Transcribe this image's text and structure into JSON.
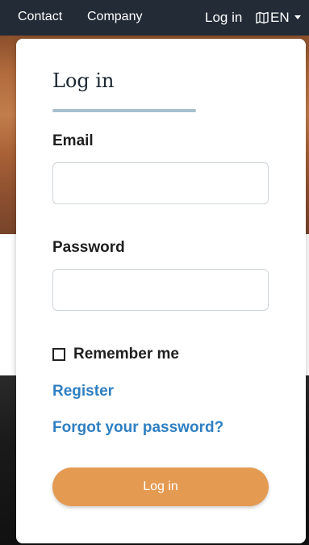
{
  "nav": {
    "contact": "Contact",
    "company": "Company",
    "login": "Log in",
    "language": "EN",
    "language_icon": "map-icon",
    "dropdown_icon": "caret-down-icon",
    "background": "#222b36"
  },
  "login_form": {
    "title": "Log in",
    "email_label": "Email",
    "email_value": "",
    "email_placeholder": "",
    "password_label": "Password",
    "password_value": "",
    "password_placeholder": "",
    "remember_label": "Remember me",
    "remember_checked": false,
    "register_link": "Register",
    "forgot_link": "Forgot your password?",
    "submit_label": "Log in",
    "colors": {
      "link": "#2f7fc1",
      "button": "#e59a52",
      "title_underline": "#a8c0cf"
    }
  }
}
